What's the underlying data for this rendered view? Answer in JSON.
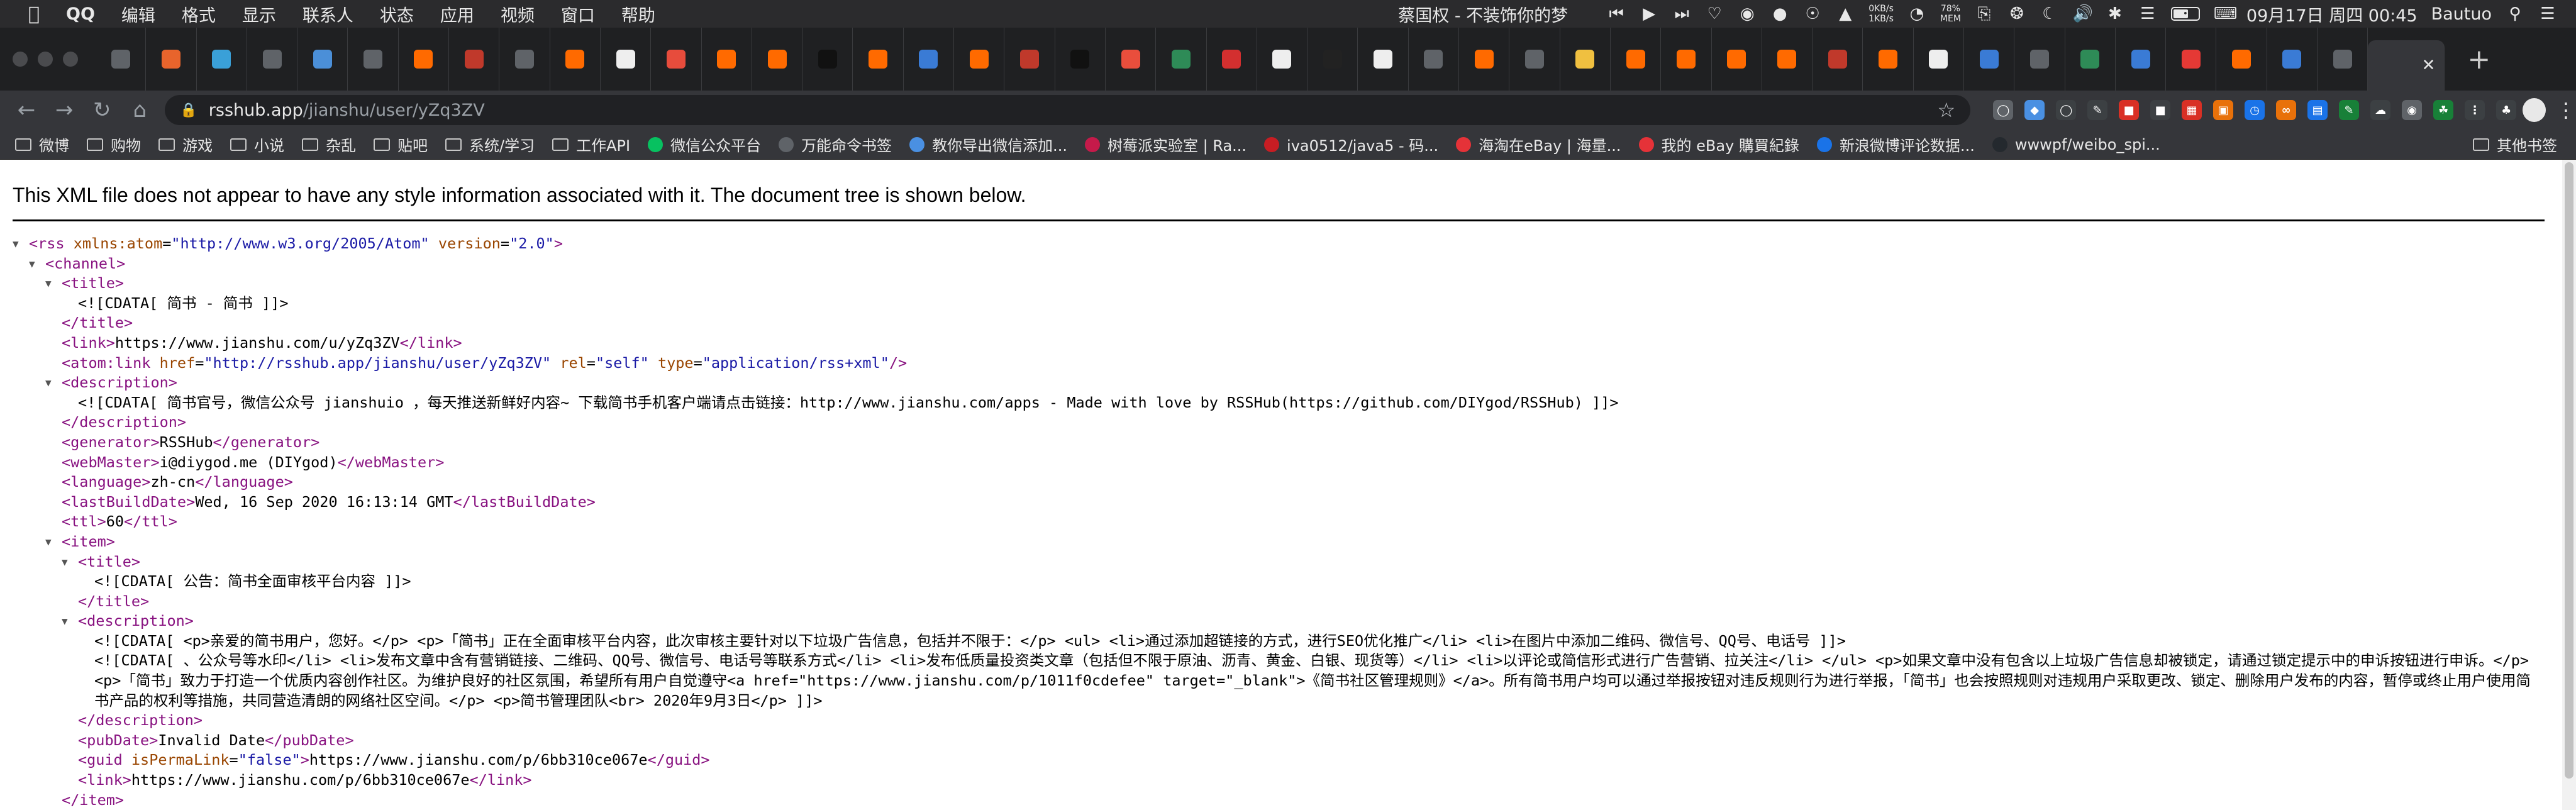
{
  "menubar": {
    "app_name": "QQ",
    "items": [
      "编辑",
      "格式",
      "显示",
      "联系人",
      "状态",
      "应用",
      "视频",
      "窗口",
      "帮助"
    ],
    "now_playing": "蔡国权 - 不装饰你的梦",
    "net_up": "0KB/s",
    "net_down": "1KB/s",
    "mem_percent": "78%",
    "mem_label": "MEM",
    "battery_level": 0.6,
    "datetime": "09月17日 周四 00:45",
    "user": "Bautuo"
  },
  "tabstrip": {
    "tab_count": 45,
    "active_tab_title": "",
    "new_tab_label": "+",
    "favicon_colors": [
      "#5f6368",
      "#e8642c",
      "#3aa0d8",
      "#5f6368",
      "#4b8fd8",
      "#5f6368",
      "#ff6a00",
      "#c0392b",
      "#5f6368",
      "#ff6a00",
      "#eeeeee",
      "#e74c3c",
      "#ff6a00",
      "#ff6a00",
      "#111111",
      "#ff6a00",
      "#3a7bd5",
      "#ff6a00",
      "#c0392b",
      "#111111",
      "#e94e3c",
      "#2e8b57",
      "#d32f2f",
      "#eeeeee",
      "#222222",
      "#eeeeee",
      "#5f6368",
      "#ff6a00",
      "#5f6368",
      "#f0c040",
      "#ff6a00",
      "#ff6a00",
      "#ff6a00",
      "#ff6a00",
      "#c0392b",
      "#ff6a00",
      "#eeeeee",
      "#3a7bd5",
      "#5f6368",
      "#2e8b57",
      "#3a7bd5",
      "#e53935",
      "#ff6a00",
      "#3a7bd5",
      "#5f6368"
    ]
  },
  "toolbar": {
    "url_host": "rsshub.app",
    "url_path": "/jianshu/user/yZq3ZV"
  },
  "bookmarks": {
    "items": [
      {
        "label": "微博",
        "icon": "folder-icon"
      },
      {
        "label": "购物",
        "icon": "folder-icon"
      },
      {
        "label": "游戏",
        "icon": "folder-icon"
      },
      {
        "label": "小说",
        "icon": "folder-icon"
      },
      {
        "label": "杂乱",
        "icon": "folder-icon"
      },
      {
        "label": "贴吧",
        "icon": "folder-icon"
      },
      {
        "label": "系统/学习",
        "icon": "folder-icon"
      },
      {
        "label": "工作API",
        "icon": "folder-icon"
      },
      {
        "label": "微信公众平台",
        "icon": "wechat-icon"
      },
      {
        "label": "万能命令书签",
        "icon": "globe-icon"
      },
      {
        "label": "教你导出微信添加...",
        "icon": "page-icon"
      },
      {
        "label": "树莓派实验室 | Ra...",
        "icon": "raspberry-icon"
      },
      {
        "label": "iva0512/java5 - 码...",
        "icon": "gitee-icon"
      },
      {
        "label": "海淘在eBay | 海量...",
        "icon": "ebay-icon"
      },
      {
        "label": "我的 eBay 購買紀錄",
        "icon": "ebay-icon"
      },
      {
        "label": "新浪微博评论数据...",
        "icon": "weibo-icon"
      },
      {
        "label": "wwwpf/weibo_spi...",
        "icon": "github-icon"
      }
    ],
    "other_label": "其他书签"
  },
  "page": {
    "notice": "This XML file does not appear to have any style information associated with it. The document tree is shown below.",
    "xml": {
      "rss_open": "<rss",
      "rss_attr1_name": "xmlns:atom",
      "rss_attr1_value": "\"http://www.w3.org/2005/Atom\"",
      "rss_attr2_name": "version",
      "rss_attr2_value": "\"2.0\"",
      "channel_open": "<channel>",
      "channel_title_open": "<title>",
      "channel_title_cdata": "<![CDATA[ 简书 - 简书 ]]>",
      "channel_title_close": "</title>",
      "link_open": "<link>",
      "link_text": "https://www.jianshu.com/u/yZq3ZV",
      "link_close": "</link>",
      "atomlink_open": "<atom:link",
      "atomlink_href_name": "href",
      "atomlink_href_value": "\"http://rsshub.app/jianshu/user/yZq3ZV\"",
      "atomlink_rel_name": "rel",
      "atomlink_rel_value": "\"self\"",
      "atomlink_type_name": "type",
      "atomlink_type_value": "\"application/rss+xml\"",
      "atomlink_close": "/>",
      "desc_open": "<description>",
      "desc_cdata": "<![CDATA[ 简书官号，微信公众号 jianshuio ，每天推送新鲜好内容~ 下载简书手机客户端请点击链接：http://www.jianshu.com/apps - Made with love by RSSHub(https://github.com/DIYgod/RSSHub) ]]>",
      "desc_close": "</description>",
      "generator_open": "<generator>",
      "generator_text": "RSSHub",
      "generator_close": "</generator>",
      "webmaster_open": "<webMaster>",
      "webmaster_text": "i@diygod.me (DIYgod)",
      "webmaster_close": "</webMaster>",
      "language_open": "<language>",
      "language_text": "zh-cn",
      "language_close": "</language>",
      "lastbuild_open": "<lastBuildDate>",
      "lastbuild_text": "Wed, 16 Sep 2020 16:13:14 GMT",
      "lastbuild_close": "</lastBuildDate>",
      "ttl_open": "<ttl>",
      "ttl_text": "60",
      "ttl_close": "</ttl>",
      "item_open": "<item>",
      "item_title_open": "<title>",
      "item_title_cdata": "<![CDATA[ 公告：简书全面审核平台内容 ]]>",
      "item_title_close": "</title>",
      "item_desc_open": "<description>",
      "item_desc_cdata_1": "<![CDATA[ <p>亲爱的简书用户，您好。</p> <p>「简书」正在全面审核平台内容，此次审核主要针对以下垃圾广告信息，包括并不限于：</p> <ul> <li>通过添加超链接的方式，进行SEO优化推广</li> <li>在图片中添加二维码、微信号、QQ号、电话号 ]]>",
      "item_desc_cdata_2": "<![CDATA[ 、公众号等水印</li> <li>发布文章中含有营销链接、二维码、QQ号、微信号、电话号等联系方式</li> <li>发布低质量投资类文章（包括但不限于原油、沥青、黄金、白银、现货等）</li> <li>以评论或简信形式进行广告营销、拉关注</li> </ul> <p>如果文章中没有包含以上垃圾广告信息却被锁定，请通过锁定提示中的申诉按钮进行申诉。</p> <p>「简书」致力于打造一个优质内容创作社区。为维护良好的社区氛围，希望所有用户自觉遵守<a href=\"https://www.jianshu.com/p/1011f0cdefee\" target=\"_blank\">《简书社区管理规则》</a>。所有简书用户均可以通过举报按钮对违反规则行为进行举报，「简书」也会按照规则对违规用户采取更改、锁定、删除用户发布的内容，暂停或终止用户使用简书产品的权利等措施，共同营造清朗的网络社区空间。</p> <p>简书管理团队<br> 2020年9月3日</p> ]]>",
      "item_desc_close": "</description>",
      "pubdate_open": "<pubDate>",
      "pubdate_text": "Invalid Date",
      "pubdate_close": "</pubDate>",
      "guid_open": "<guid",
      "guid_attr_name": "isPermaLink",
      "guid_attr_value": "\"false\"",
      "guid_gt": ">",
      "guid_text": "https://www.jianshu.com/p/6bb310ce067e",
      "guid_close": "</guid>",
      "item_link_open": "<link>",
      "item_link_text": "https://www.jianshu.com/p/6bb310ce067e",
      "item_link_close": "</link>",
      "item_close": "</item>"
    }
  }
}
